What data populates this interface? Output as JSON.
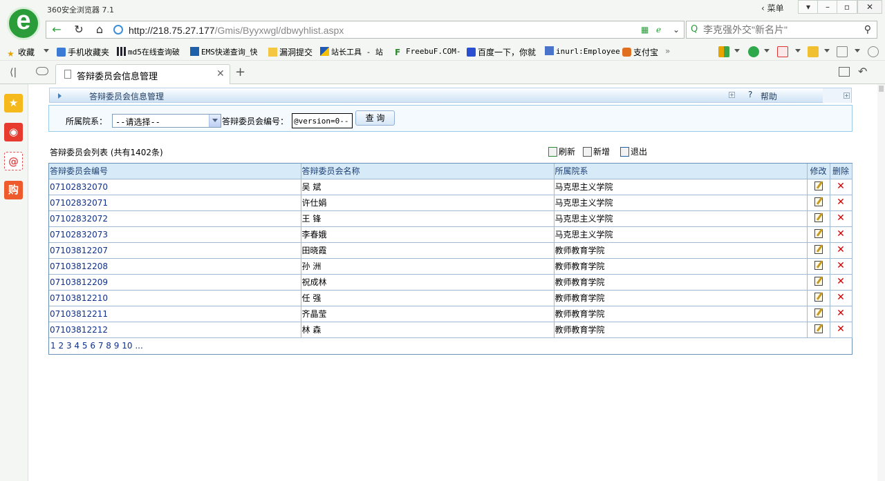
{
  "browser": {
    "app_title": "360安全浏览器 7.1",
    "menu_label": "菜单",
    "url_host": "http://218.75.27.177",
    "url_path": "/Gmis/Byyxwgl/dbwyhlist.aspx",
    "search_placeholder": "李克强外交\"新名片\"",
    "tab_title": "答辩委员会信息管理",
    "window_buttons": [
      "minimize-icon",
      "restore-icon",
      "close-icon"
    ]
  },
  "favorites": [
    {
      "label": "收藏",
      "icon": "star-plus-icon"
    },
    {
      "label": "手机收藏夹",
      "icon": "phone-icon"
    },
    {
      "label": "md5在线查询破",
      "icon": "grid-icon"
    },
    {
      "label": "EMS快递查询_快",
      "icon": "ems-icon"
    },
    {
      "label": "漏洞提交",
      "icon": "folder-icon"
    },
    {
      "label": "站长工具 - 站",
      "icon": "chinaz-icon"
    },
    {
      "label": "FreebuF.COM-",
      "icon": "freebuf-icon"
    },
    {
      "label": "百度一下，你就",
      "icon": "baidu-icon"
    },
    {
      "label": "inurl:Employee",
      "icon": "google-icon"
    },
    {
      "label": "支付宝",
      "icon": "alipay-icon"
    }
  ],
  "page": {
    "header_title": "答辩委员会信息管理",
    "help_label": "帮助",
    "filter": {
      "dept_label": "所属院系：",
      "dept_selected": "--请选择--",
      "code_label": "答辩委员会编号：",
      "code_value": "@version=0--",
      "query_label": "查 询"
    },
    "list_caption": "答辩委员会列表 (共有1402条)",
    "actions": {
      "refresh": "刷新",
      "add": "新增",
      "exit": "退出"
    },
    "columns": [
      "答辩委员会编号",
      "答辩委员会名称",
      "所属院系",
      "修改",
      "删除"
    ],
    "rows": [
      {
        "code": "07102832070",
        "name": "吴 斌",
        "dept": "马克思主义学院"
      },
      {
        "code": "07102832071",
        "name": "许仕娟",
        "dept": "马克思主义学院"
      },
      {
        "code": "07102832072",
        "name": "王 锋",
        "dept": "马克思主义学院"
      },
      {
        "code": "07102832073",
        "name": "李春娥",
        "dept": "马克思主义学院"
      },
      {
        "code": "07103812207",
        "name": "田晓霞",
        "dept": "教师教育学院"
      },
      {
        "code": "07103812208",
        "name": "孙 洲",
        "dept": "教师教育学院"
      },
      {
        "code": "07103812209",
        "name": "祝成林",
        "dept": "教师教育学院"
      },
      {
        "code": "07103812210",
        "name": "任 强",
        "dept": "教师教育学院"
      },
      {
        "code": "07103812211",
        "name": "齐晶莹",
        "dept": "教师教育学院"
      },
      {
        "code": "07103812212",
        "name": "林 森",
        "dept": "教师教育学院"
      }
    ],
    "pager": [
      "1",
      "2",
      "3",
      "4",
      "5",
      "6",
      "7",
      "8",
      "9",
      "10",
      "..."
    ]
  }
}
